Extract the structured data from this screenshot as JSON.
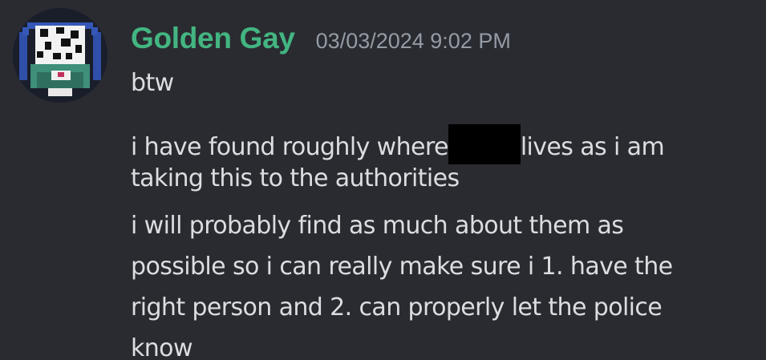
{
  "message": {
    "author": "Golden Gay",
    "author_color": "#43b581",
    "timestamp": "03/03/2024 9:02 PM",
    "avatar_icon": "pixel-art-mushroom-avatar",
    "lines": [
      "btw",
      "i have found roughly where",
      "lives as i am",
      "taking this to the authorities",
      "i will  probably find as much about them as",
      "possible so i can   really make sure i 1. have the",
      "right person and 2. can properly let the police",
      "know"
    ],
    "redaction_color": "#000000"
  }
}
